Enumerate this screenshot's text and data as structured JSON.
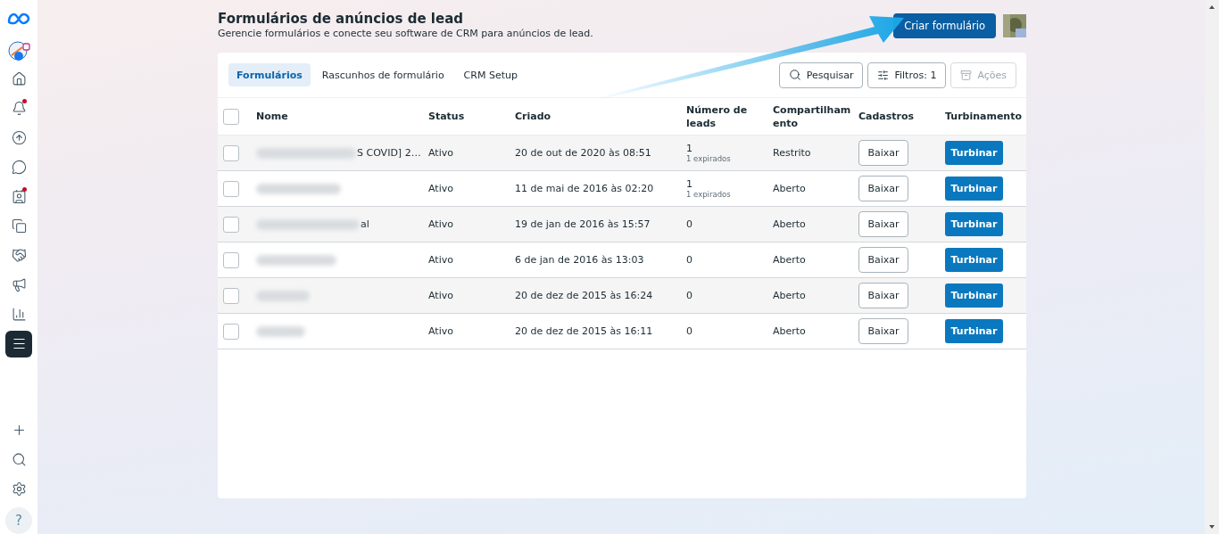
{
  "sidebar": {
    "nav_items": [
      {
        "selected": false,
        "badge": false
      },
      {
        "selected": false,
        "badge": true
      },
      {
        "selected": false,
        "badge": false
      },
      {
        "selected": false,
        "badge": false
      },
      {
        "selected": false,
        "badge": true
      },
      {
        "selected": false,
        "badge": false
      },
      {
        "selected": false,
        "badge": false
      },
      {
        "selected": false,
        "badge": false
      },
      {
        "selected": false,
        "badge": false
      },
      {
        "selected": true,
        "badge": false
      }
    ],
    "help": "?"
  },
  "header": {
    "title": "Formulários de anúncios de lead",
    "subtitle": "Gerencie formulários e conecte seu software de CRM para anúncios de lead.",
    "create_button": "Criar formulário"
  },
  "tabs": [
    {
      "label": "Formulários",
      "selected": true
    },
    {
      "label": "Rascunhos de formulário",
      "selected": false
    },
    {
      "label": "CRM Setup",
      "selected": false
    }
  ],
  "toolbar": {
    "search": "Pesquisar",
    "filters": "Filtros: 1",
    "actions": {
      "label": "Ações",
      "disabled": true
    }
  },
  "table": {
    "select_all_checked": false,
    "columns": [
      "Nome",
      "Status",
      "Criado",
      "Número de leads",
      "Compartilhamento",
      "Cadastros",
      "Turbinamento"
    ],
    "rows": [
      {
        "checked": false,
        "name_visible": "S COVID] 2…",
        "status": "Ativo",
        "created": "20 de out de 2020 às 08:51",
        "leads": "1",
        "expired": "1 expirados",
        "sharing": "Restrito",
        "download": "Baixar",
        "boost": "Turbinar"
      },
      {
        "checked": false,
        "status": "Ativo",
        "created": "11 de mai de 2016 às 02:20",
        "leads": "1",
        "expired": "1 expirados",
        "sharing": "Aberto",
        "download": "Baixar",
        "boost": "Turbinar"
      },
      {
        "checked": false,
        "name_visible": "al",
        "status": "Ativo",
        "created": "19 de jan de 2016 às 15:57",
        "leads": "0",
        "sharing": "Aberto",
        "download": "Baixar",
        "boost": "Turbinar"
      },
      {
        "checked": false,
        "status": "Ativo",
        "created": "6 de jan de 2016 às 13:03",
        "leads": "0",
        "sharing": "Aberto",
        "download": "Baixar",
        "boost": "Turbinar"
      },
      {
        "checked": false,
        "status": "Ativo",
        "created": "20 de dez de 2015 às 16:24",
        "leads": "0",
        "sharing": "Aberto",
        "download": "Baixar",
        "boost": "Turbinar"
      },
      {
        "checked": false,
        "status": "Ativo",
        "created": "20 de dez de 2015 às 16:11",
        "leads": "0",
        "sharing": "Aberto",
        "download": "Baixar",
        "boost": "Turbinar"
      }
    ]
  }
}
